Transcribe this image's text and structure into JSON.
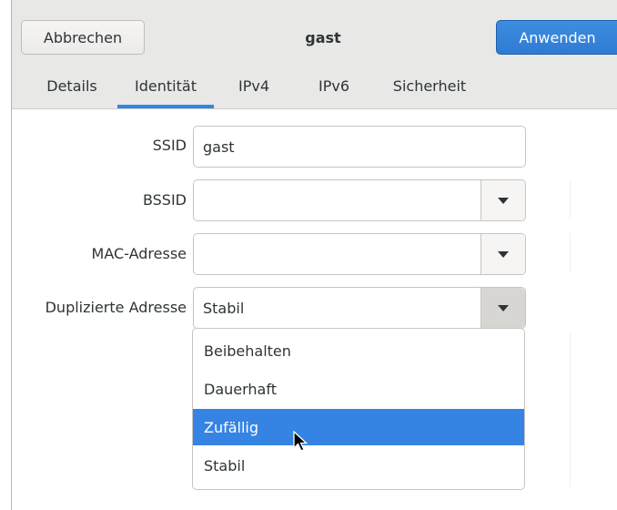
{
  "header": {
    "cancel_label": "Abbrechen",
    "title": "gast",
    "apply_label": "Anwenden"
  },
  "tabs": [
    {
      "label": "Details",
      "active": false
    },
    {
      "label": "Identität",
      "active": true
    },
    {
      "label": "IPv4",
      "active": false
    },
    {
      "label": "IPv6",
      "active": false
    },
    {
      "label": "Sicherheit",
      "active": false
    }
  ],
  "form": {
    "ssid": {
      "label": "SSID",
      "value": "gast"
    },
    "bssid": {
      "label": "BSSID",
      "value": ""
    },
    "mac": {
      "label": "MAC-Adresse",
      "value": ""
    },
    "dup": {
      "label": "Duplizierte Adresse",
      "value": "Stabil"
    }
  },
  "dropdown": {
    "options": [
      "Beibehalten",
      "Dauerhaft",
      "Zufällig",
      "Stabil"
    ],
    "highlighted": "Zufällig"
  },
  "colors": {
    "accent": "#3584e4",
    "headerbar": "#e8e8e7"
  }
}
